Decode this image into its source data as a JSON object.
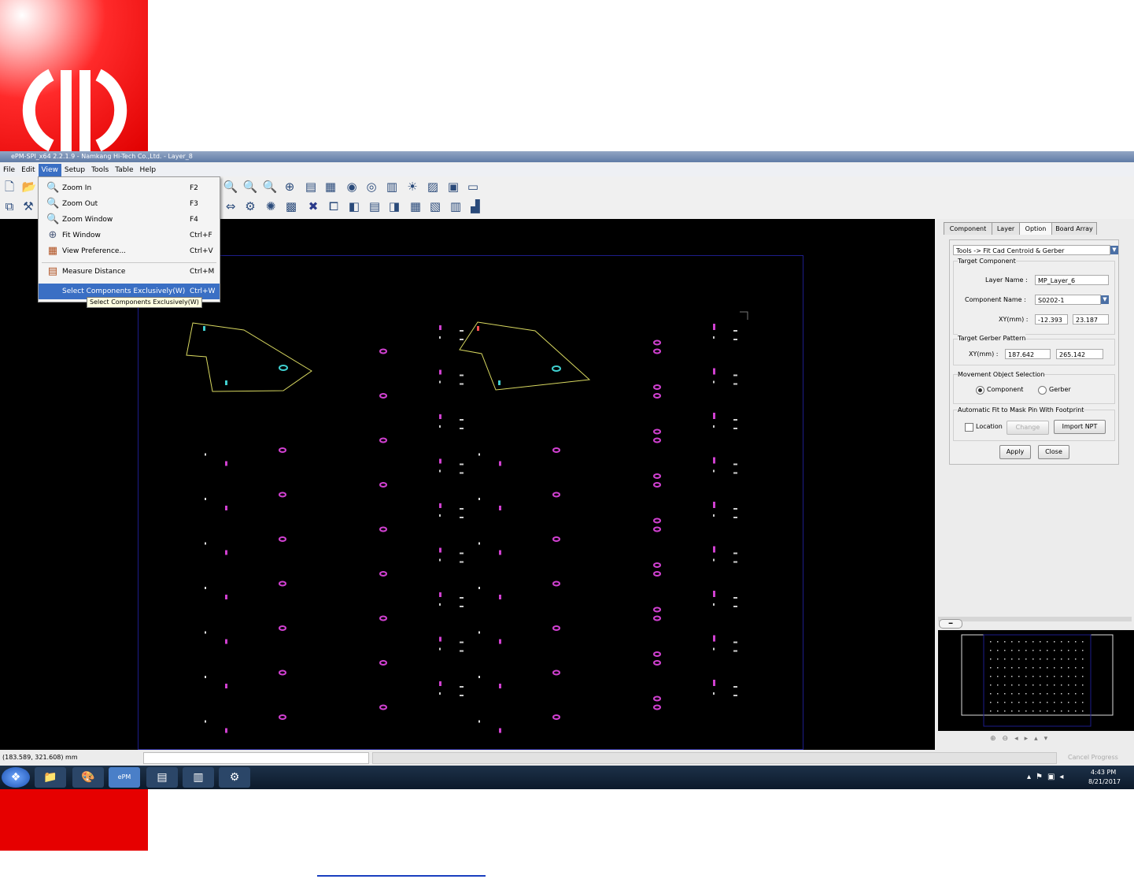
{
  "window": {
    "title": "ePM-SPI_x64 2.2.1.9 - Namkang Hi-Tech Co.,Ltd. - Layer_8"
  },
  "menubar": {
    "items": [
      "File",
      "Edit",
      "View",
      "Setup",
      "Tools",
      "Table",
      "Help"
    ]
  },
  "view_menu": {
    "items": [
      {
        "label": "Zoom In",
        "shortcut": "F2",
        "icon": "zoom-in-icon"
      },
      {
        "label": "Zoom Out",
        "shortcut": "F3",
        "icon": "zoom-out-icon"
      },
      {
        "label": "Zoom Window",
        "shortcut": "F4",
        "icon": "zoom-window-icon"
      },
      {
        "label": "Fit Window",
        "shortcut": "Ctrl+F",
        "icon": "fit-window-icon"
      },
      {
        "label": "View Preference...",
        "shortcut": "Ctrl+V",
        "icon": "preference-icon"
      },
      {
        "label": "Measure Distance",
        "shortcut": "Ctrl+M",
        "icon": "measure-icon"
      },
      {
        "label": "Select Components Exclusively(W)",
        "shortcut": "Ctrl+W",
        "icon": ""
      }
    ],
    "tooltip": "Select Components Exclusively(W)"
  },
  "panel": {
    "tabs": [
      "Component",
      "Layer",
      "Option",
      "Board Array"
    ],
    "active_tab": "Option",
    "tool_select": "Tools -> Fit Cad Centroid & Gerber",
    "target_component": {
      "title": "Target Component",
      "layer_name_label": "Layer Name :",
      "layer_name": "MP_Layer_6",
      "component_name_label": "Component Name :",
      "component_name": "S0202-1",
      "xy_label": "XY(mm) :",
      "x": "-12.393",
      "y": "23.187"
    },
    "target_gerber": {
      "title": "Target Gerber Pattern",
      "xy_label": "XY(mm) :",
      "x": "187.642",
      "y": "265.142"
    },
    "movement": {
      "title": "Movement Object Selection",
      "options": [
        "Component",
        "Gerber"
      ],
      "selected": "Component"
    },
    "auto_fit": {
      "title": "Automatic Fit to Mask Pin With Footprint",
      "location_label": "Location",
      "change_label": "Change",
      "import_label": "Import NPT"
    },
    "apply_label": "Apply",
    "close_label": "Close"
  },
  "status": {
    "coords": "(183.589, 321.608) mm",
    "cancel_label": "Cancel Progress"
  },
  "taskbar": {
    "time": "4:43 PM",
    "date": "8/21/2017",
    "epm_label": "ePM"
  },
  "colors": {
    "pad": "#d040d0",
    "outline": "#d8d860",
    "accent": "#3a6fc4"
  }
}
